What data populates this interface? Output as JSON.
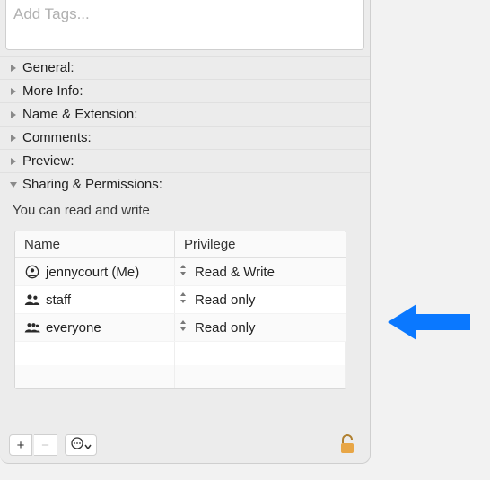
{
  "tags": {
    "placeholder": "Add Tags..."
  },
  "sections": {
    "general": "General:",
    "more_info": "More Info:",
    "name_ext": "Name & Extension:",
    "comments": "Comments:",
    "preview": "Preview:",
    "sharing": "Sharing & Permissions:"
  },
  "permissions": {
    "status": "You can read and write",
    "columns": {
      "name": "Name",
      "privilege": "Privilege"
    },
    "rows": [
      {
        "icon": "user",
        "name": "jennycourt (Me)",
        "privilege": "Read & Write"
      },
      {
        "icon": "group",
        "name": "staff",
        "privilege": "Read only"
      },
      {
        "icon": "group",
        "name": "everyone",
        "privilege": "Read only"
      }
    ]
  },
  "toolbar": {
    "add": "+",
    "remove": "−",
    "action": "⊙"
  }
}
